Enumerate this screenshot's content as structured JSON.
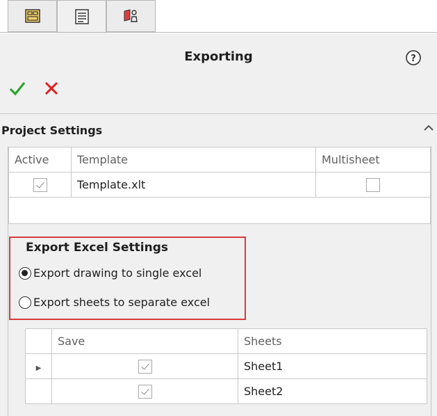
{
  "tabs": [
    {
      "icon": "property-panel-icon",
      "active": false
    },
    {
      "icon": "list-view-icon",
      "active": true
    },
    {
      "icon": "security-tools-icon",
      "active": false
    }
  ],
  "header": {
    "title": "Exporting",
    "help_icon": "help-icon"
  },
  "actions": {
    "ok_icon": "checkmark-icon",
    "cancel_icon": "close-icon",
    "ok_color": "#2aa52a",
    "cancel_color": "#e02020"
  },
  "project_settings": {
    "title": "Project Settings",
    "collapse_icon": "chevron-up-icon",
    "columns": [
      "Active",
      "Template",
      "Multisheet"
    ],
    "rows": [
      {
        "active": true,
        "template": "Template.xlt",
        "multisheet": false
      }
    ]
  },
  "export_settings": {
    "title": "Export Excel Settings",
    "options": [
      {
        "label": "Export drawing to single excel",
        "selected": true
      },
      {
        "label": "Export sheets to separate excel",
        "selected": false
      }
    ],
    "highlight_color": "#d93a3a"
  },
  "sheets_table": {
    "columns": [
      "Save",
      "Sheets"
    ],
    "rows": [
      {
        "save": true,
        "sheet": "Sheet1",
        "current": true
      },
      {
        "save": true,
        "sheet": "Sheet2",
        "current": false
      }
    ]
  }
}
